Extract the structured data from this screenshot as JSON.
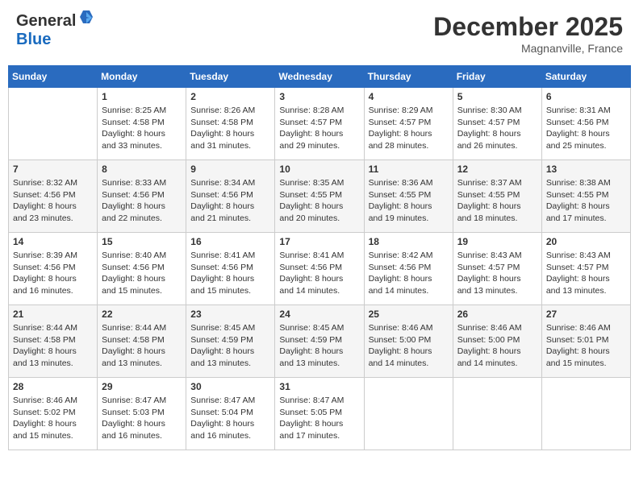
{
  "header": {
    "logo_general": "General",
    "logo_blue": "Blue",
    "month": "December 2025",
    "location": "Magnanville, France"
  },
  "days_of_week": [
    "Sunday",
    "Monday",
    "Tuesday",
    "Wednesday",
    "Thursday",
    "Friday",
    "Saturday"
  ],
  "weeks": [
    [
      {
        "day": "",
        "sunrise": "",
        "sunset": "",
        "daylight": ""
      },
      {
        "day": "1",
        "sunrise": "Sunrise: 8:25 AM",
        "sunset": "Sunset: 4:58 PM",
        "daylight": "Daylight: 8 hours and 33 minutes."
      },
      {
        "day": "2",
        "sunrise": "Sunrise: 8:26 AM",
        "sunset": "Sunset: 4:58 PM",
        "daylight": "Daylight: 8 hours and 31 minutes."
      },
      {
        "day": "3",
        "sunrise": "Sunrise: 8:28 AM",
        "sunset": "Sunset: 4:57 PM",
        "daylight": "Daylight: 8 hours and 29 minutes."
      },
      {
        "day": "4",
        "sunrise": "Sunrise: 8:29 AM",
        "sunset": "Sunset: 4:57 PM",
        "daylight": "Daylight: 8 hours and 28 minutes."
      },
      {
        "day": "5",
        "sunrise": "Sunrise: 8:30 AM",
        "sunset": "Sunset: 4:57 PM",
        "daylight": "Daylight: 8 hours and 26 minutes."
      },
      {
        "day": "6",
        "sunrise": "Sunrise: 8:31 AM",
        "sunset": "Sunset: 4:56 PM",
        "daylight": "Daylight: 8 hours and 25 minutes."
      }
    ],
    [
      {
        "day": "7",
        "sunrise": "Sunrise: 8:32 AM",
        "sunset": "Sunset: 4:56 PM",
        "daylight": "Daylight: 8 hours and 23 minutes."
      },
      {
        "day": "8",
        "sunrise": "Sunrise: 8:33 AM",
        "sunset": "Sunset: 4:56 PM",
        "daylight": "Daylight: 8 hours and 22 minutes."
      },
      {
        "day": "9",
        "sunrise": "Sunrise: 8:34 AM",
        "sunset": "Sunset: 4:56 PM",
        "daylight": "Daylight: 8 hours and 21 minutes."
      },
      {
        "day": "10",
        "sunrise": "Sunrise: 8:35 AM",
        "sunset": "Sunset: 4:55 PM",
        "daylight": "Daylight: 8 hours and 20 minutes."
      },
      {
        "day": "11",
        "sunrise": "Sunrise: 8:36 AM",
        "sunset": "Sunset: 4:55 PM",
        "daylight": "Daylight: 8 hours and 19 minutes."
      },
      {
        "day": "12",
        "sunrise": "Sunrise: 8:37 AM",
        "sunset": "Sunset: 4:55 PM",
        "daylight": "Daylight: 8 hours and 18 minutes."
      },
      {
        "day": "13",
        "sunrise": "Sunrise: 8:38 AM",
        "sunset": "Sunset: 4:55 PM",
        "daylight": "Daylight: 8 hours and 17 minutes."
      }
    ],
    [
      {
        "day": "14",
        "sunrise": "Sunrise: 8:39 AM",
        "sunset": "Sunset: 4:56 PM",
        "daylight": "Daylight: 8 hours and 16 minutes."
      },
      {
        "day": "15",
        "sunrise": "Sunrise: 8:40 AM",
        "sunset": "Sunset: 4:56 PM",
        "daylight": "Daylight: 8 hours and 15 minutes."
      },
      {
        "day": "16",
        "sunrise": "Sunrise: 8:41 AM",
        "sunset": "Sunset: 4:56 PM",
        "daylight": "Daylight: 8 hours and 15 minutes."
      },
      {
        "day": "17",
        "sunrise": "Sunrise: 8:41 AM",
        "sunset": "Sunset: 4:56 PM",
        "daylight": "Daylight: 8 hours and 14 minutes."
      },
      {
        "day": "18",
        "sunrise": "Sunrise: 8:42 AM",
        "sunset": "Sunset: 4:56 PM",
        "daylight": "Daylight: 8 hours and 14 minutes."
      },
      {
        "day": "19",
        "sunrise": "Sunrise: 8:43 AM",
        "sunset": "Sunset: 4:57 PM",
        "daylight": "Daylight: 8 hours and 13 minutes."
      },
      {
        "day": "20",
        "sunrise": "Sunrise: 8:43 AM",
        "sunset": "Sunset: 4:57 PM",
        "daylight": "Daylight: 8 hours and 13 minutes."
      }
    ],
    [
      {
        "day": "21",
        "sunrise": "Sunrise: 8:44 AM",
        "sunset": "Sunset: 4:58 PM",
        "daylight": "Daylight: 8 hours and 13 minutes."
      },
      {
        "day": "22",
        "sunrise": "Sunrise: 8:44 AM",
        "sunset": "Sunset: 4:58 PM",
        "daylight": "Daylight: 8 hours and 13 minutes."
      },
      {
        "day": "23",
        "sunrise": "Sunrise: 8:45 AM",
        "sunset": "Sunset: 4:59 PM",
        "daylight": "Daylight: 8 hours and 13 minutes."
      },
      {
        "day": "24",
        "sunrise": "Sunrise: 8:45 AM",
        "sunset": "Sunset: 4:59 PM",
        "daylight": "Daylight: 8 hours and 13 minutes."
      },
      {
        "day": "25",
        "sunrise": "Sunrise: 8:46 AM",
        "sunset": "Sunset: 5:00 PM",
        "daylight": "Daylight: 8 hours and 14 minutes."
      },
      {
        "day": "26",
        "sunrise": "Sunrise: 8:46 AM",
        "sunset": "Sunset: 5:00 PM",
        "daylight": "Daylight: 8 hours and 14 minutes."
      },
      {
        "day": "27",
        "sunrise": "Sunrise: 8:46 AM",
        "sunset": "Sunset: 5:01 PM",
        "daylight": "Daylight: 8 hours and 15 minutes."
      }
    ],
    [
      {
        "day": "28",
        "sunrise": "Sunrise: 8:46 AM",
        "sunset": "Sunset: 5:02 PM",
        "daylight": "Daylight: 8 hours and 15 minutes."
      },
      {
        "day": "29",
        "sunrise": "Sunrise: 8:47 AM",
        "sunset": "Sunset: 5:03 PM",
        "daylight": "Daylight: 8 hours and 16 minutes."
      },
      {
        "day": "30",
        "sunrise": "Sunrise: 8:47 AM",
        "sunset": "Sunset: 5:04 PM",
        "daylight": "Daylight: 8 hours and 16 minutes."
      },
      {
        "day": "31",
        "sunrise": "Sunrise: 8:47 AM",
        "sunset": "Sunset: 5:05 PM",
        "daylight": "Daylight: 8 hours and 17 minutes."
      },
      {
        "day": "",
        "sunrise": "",
        "sunset": "",
        "daylight": ""
      },
      {
        "day": "",
        "sunrise": "",
        "sunset": "",
        "daylight": ""
      },
      {
        "day": "",
        "sunrise": "",
        "sunset": "",
        "daylight": ""
      }
    ]
  ]
}
